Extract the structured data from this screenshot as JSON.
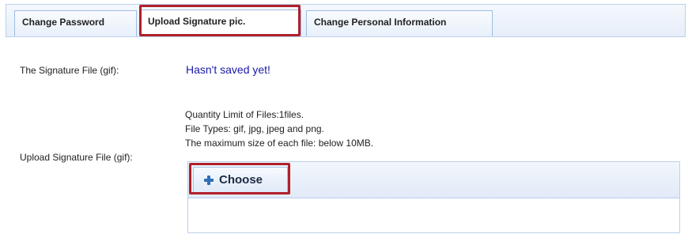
{
  "tabs": {
    "items": [
      {
        "label": "Change Password"
      },
      {
        "label": "Upload Signature pic."
      },
      {
        "label": "Change Personal Information"
      }
    ],
    "active_index": 1
  },
  "form": {
    "signature_label": "The Signature File (gif):",
    "signature_status": "Hasn't saved yet!",
    "upload_label": "Upload Signature File (gif):",
    "limits": {
      "quantity": "Quantity Limit of Files:1files.",
      "file_types": "File Types: gif, jpg, jpeg and png.",
      "max_size": "The maximum size of each file: below 10MB."
    }
  },
  "uploader": {
    "choose_label": "Choose",
    "choose_icon": "plus-icon"
  },
  "colors": {
    "status_text": "#1a1aa8",
    "highlight": "#b0202a",
    "tab_border": "#9fbde4"
  }
}
